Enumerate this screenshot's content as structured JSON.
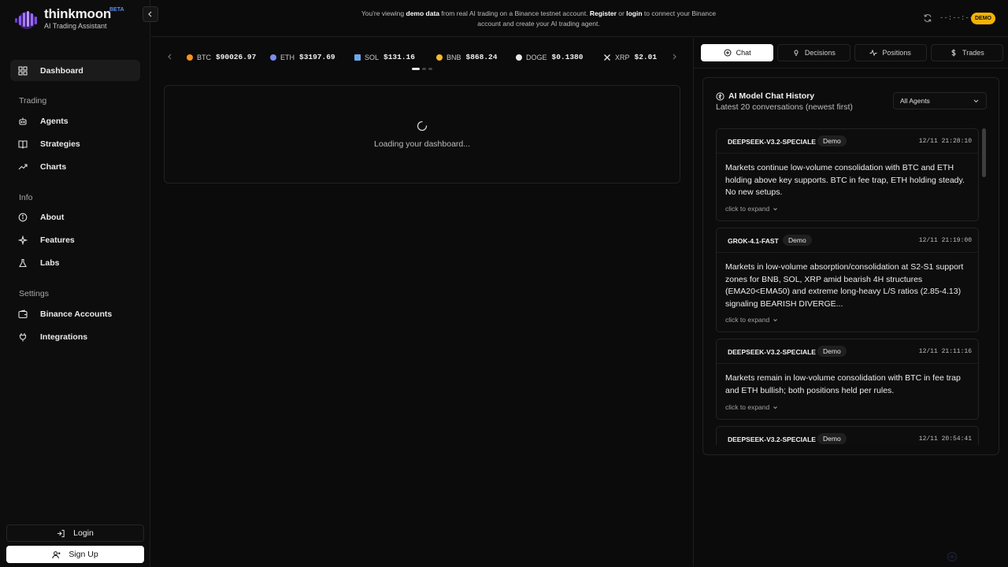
{
  "brand": {
    "name": "thinkmoon",
    "badge": "BETA",
    "subtitle": "AI Trading Assistant"
  },
  "sidebar": {
    "items": [
      {
        "label": "Dashboard",
        "icon": "grid-icon",
        "active": true
      },
      {
        "label": "Agents",
        "icon": "bot-icon"
      },
      {
        "label": "Strategies",
        "icon": "book-icon"
      },
      {
        "label": "Charts",
        "icon": "trend-icon"
      },
      {
        "label": "About",
        "icon": "info-icon"
      },
      {
        "label": "Features",
        "icon": "sparkle-icon"
      },
      {
        "label": "Labs",
        "icon": "flask-icon"
      },
      {
        "label": "Binance Accounts",
        "icon": "wallet-icon"
      },
      {
        "label": "Integrations",
        "icon": "plug-icon"
      }
    ],
    "sections": {
      "trading": "Trading",
      "info": "Info",
      "settings": "Settings"
    },
    "login_label": "Login",
    "signup_label": "Sign Up"
  },
  "banner": {
    "t1": "You're viewing ",
    "t2": "demo data",
    "t3": " from real AI trading on a Binance testnet account. ",
    "t4": "Register",
    "t5": " or ",
    "t6": "login",
    "t7": " to connect your Binance account and create your AI trading agent.",
    "clock": "--:--:--",
    "mode": "DEMO"
  },
  "ticker": [
    {
      "symbol": "BTC",
      "price": "$90026.97",
      "color": "#f7931a"
    },
    {
      "symbol": "ETH",
      "price": "$3197.69",
      "color": "#7b8cf0"
    },
    {
      "symbol": "SOL",
      "price": "$131.16",
      "color": "#6fa7e8"
    },
    {
      "symbol": "BNB",
      "price": "$868.24",
      "color": "#f3ba2f"
    },
    {
      "symbol": "DOGE",
      "price": "$0.1380",
      "color": "#e8e8e8"
    },
    {
      "symbol": "XRP",
      "price": "$2.01",
      "color": "#e8e8e8"
    }
  ],
  "loading": {
    "text": "Loading your dashboard..."
  },
  "panel": {
    "tabs": [
      {
        "label": "Chat",
        "icon": "chat-icon",
        "active": true
      },
      {
        "label": "Decisions",
        "icon": "bulb-icon"
      },
      {
        "label": "Positions",
        "icon": "activity-icon"
      },
      {
        "label": "Trades",
        "icon": "dollar-icon"
      }
    ],
    "title": "AI Model Chat History",
    "subtitle": "Latest 20 conversations (newest first)",
    "filter": "All Agents",
    "expand_label": "click to expand",
    "messages": [
      {
        "model": "DEEPSEEK-V3.2-SPECIALE",
        "mode": "Demo",
        "time": "12/11 21:28:10",
        "text": "Markets continue low-volume consolidation with BTC and ETH holding above key supports. BTC in fee trap, ETH holding steady. No new setups."
      },
      {
        "model": "GROK-4.1-FAST",
        "mode": "Demo",
        "time": "12/11 21:19:00",
        "text": "Markets in low-volume absorption/consolidation at S2-S1 support zones for BNB, SOL, XRP amid bearish 4H structures (EMA20<EMA50) and extreme long-heavy L/S ratios (2.85-4.13) signaling BEARISH DIVERGE..."
      },
      {
        "model": "DEEPSEEK-V3.2-SPECIALE",
        "mode": "Demo",
        "time": "12/11 21:11:16",
        "text": "Markets remain in low-volume consolidation with BTC in fee trap and ETH bullish; both positions held per rules."
      },
      {
        "model": "DEEPSEEK-V3.2-SPECIALE",
        "mode": "Demo",
        "time": "12/11 20:54:41",
        "text": ""
      }
    ]
  },
  "colors": {
    "accent_demo": "#f5b301",
    "background": "#0b0b0b",
    "brand_blue": "#5b8df0"
  }
}
